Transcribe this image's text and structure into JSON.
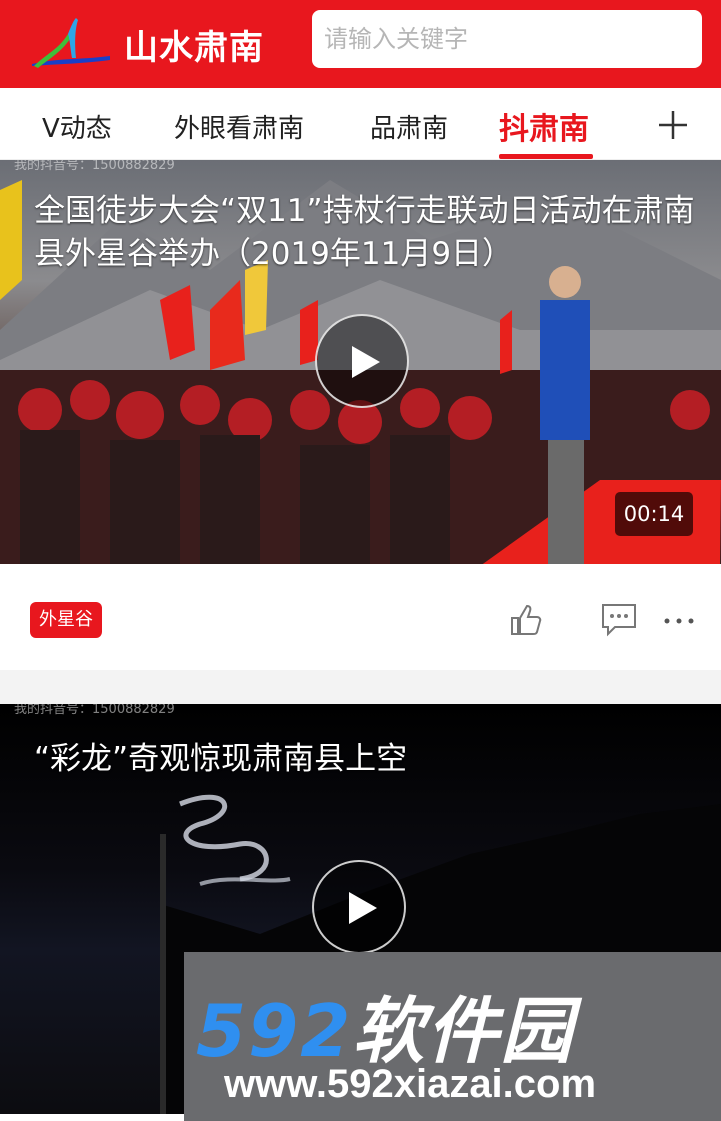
{
  "header": {
    "app_name": "山水肃南",
    "search_placeholder": "请输入关键字",
    "brand_color": "#e8171e"
  },
  "tabs": {
    "items": [
      {
        "label": "V动态",
        "active": false
      },
      {
        "label": "外眼看肃南",
        "active": false
      },
      {
        "label": "品肃南",
        "active": false
      },
      {
        "label": "抖肃南",
        "active": true
      }
    ],
    "add_icon": "plus-icon"
  },
  "videos": [
    {
      "title": "全国徒步大会“双11”持杖行走联动日活动在肃南县外星谷举办（2019年11月9日）",
      "duration": "00:14",
      "corner_text": "我的抖音号：1500882829",
      "tag": "外星谷"
    },
    {
      "title": "“彩龙”奇观惊现肃南县上空",
      "corner_text": "我的抖音号：1500882829"
    }
  ],
  "actions": {
    "like_icon": "thumbs-up-icon",
    "comment_icon": "comment-icon",
    "more_icon": "more-icon"
  },
  "overlay": {
    "big_num": "592",
    "big_cn": "软件园",
    "url": "www.592xiazai.com",
    "accent": "#2f8ff0"
  }
}
